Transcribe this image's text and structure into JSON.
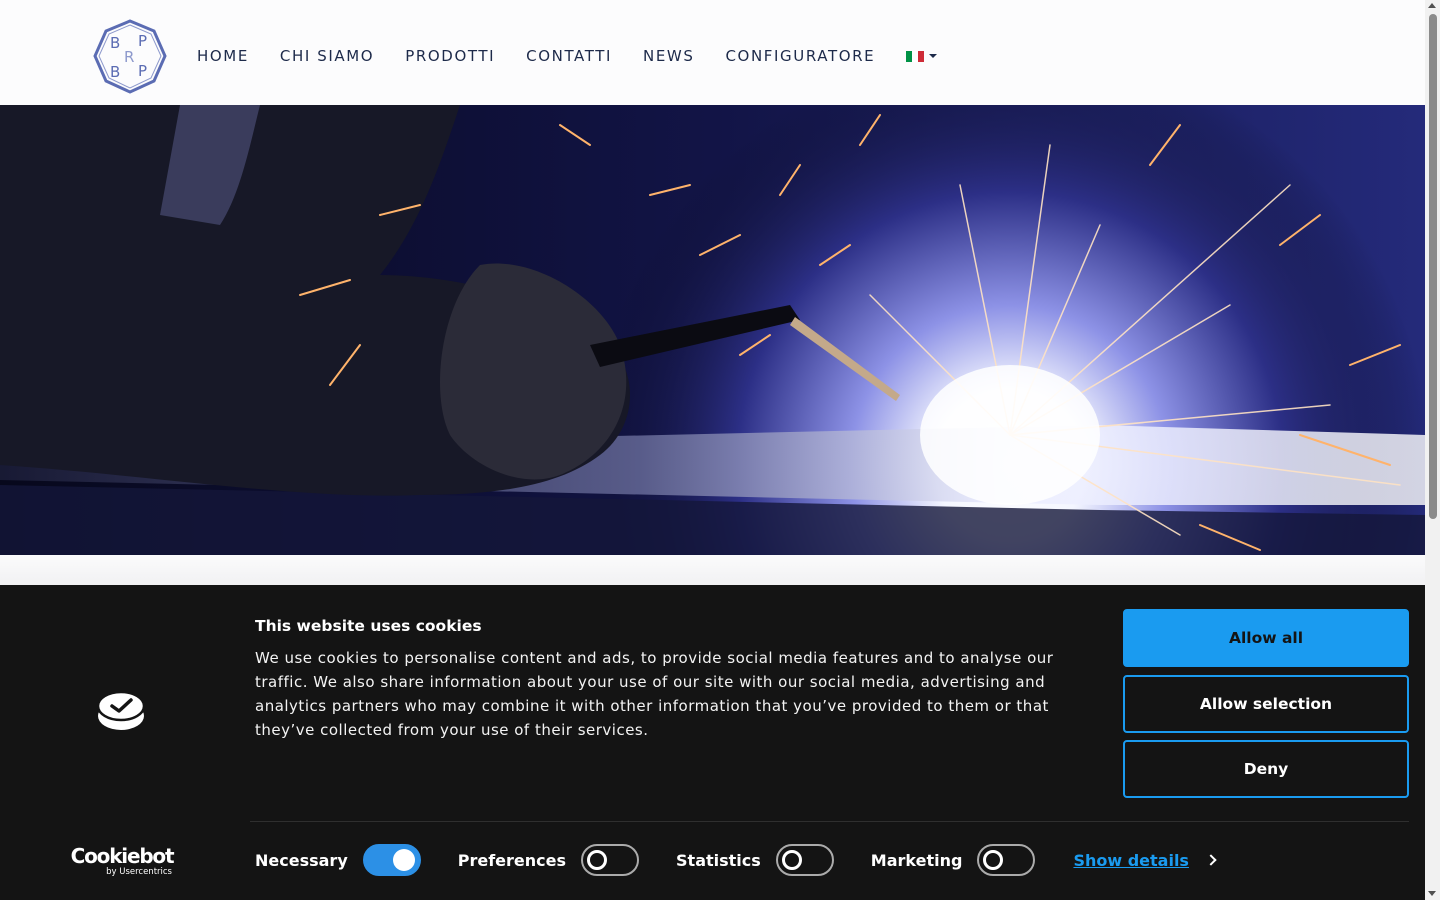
{
  "logo": {
    "letters": [
      "B",
      "P",
      "R",
      "B",
      "P"
    ],
    "color": "#5b6cb3"
  },
  "nav": {
    "items": [
      {
        "label": "HOME"
      },
      {
        "label": "CHI SIAMO"
      },
      {
        "label": "PRODOTTI"
      },
      {
        "label": "CONTATTI"
      },
      {
        "label": "NEWS"
      },
      {
        "label": "CONFIGURATORE"
      }
    ],
    "language": {
      "icon": "italy-flag-icon",
      "colors": [
        "#009246",
        "#ffffff",
        "#ce2b37"
      ]
    }
  },
  "hero": {
    "image": "welding-sparks-photo"
  },
  "cookie_banner": {
    "title": "This website uses cookies",
    "text": "We use cookies to personalise content and ads, to provide social media features and to analyse our traffic. We also share information about your use of our site with our social media, advertising and analytics partners who may combine it with other information that you’ve provided to them or that they’ve collected from your use of their services.",
    "brand": {
      "name": "Cookiebot",
      "byline": "by Usercentrics"
    },
    "buttons": {
      "allow_all": "Allow all",
      "allow_selection": "Allow selection",
      "deny": "Deny"
    },
    "consents": [
      {
        "label": "Necessary",
        "enabled": true
      },
      {
        "label": "Preferences",
        "enabled": false
      },
      {
        "label": "Statistics",
        "enabled": false
      },
      {
        "label": "Marketing",
        "enabled": false
      }
    ],
    "show_details": "Show details",
    "accent_color": "#1a9bf0"
  }
}
